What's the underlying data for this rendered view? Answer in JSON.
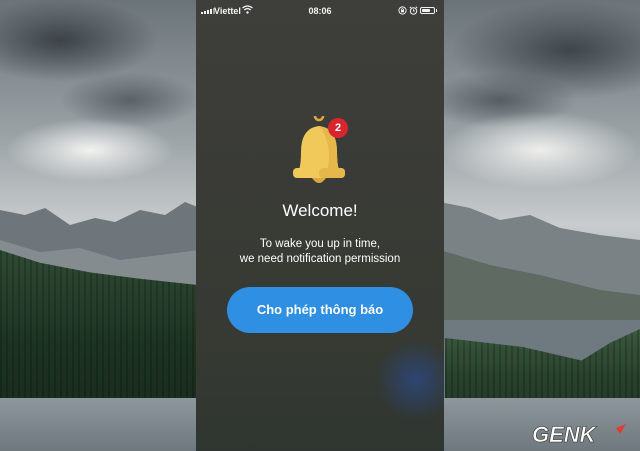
{
  "status_bar": {
    "carrier": "Viettel",
    "time": "08:06",
    "icons": [
      "signal-icon",
      "wifi-icon",
      "lock-rotation-icon",
      "alarm-icon",
      "battery-icon"
    ],
    "battery_level": 0.75
  },
  "welcome": {
    "icon": "bell-icon",
    "badge_count": "2",
    "title": "Welcome!",
    "message_lines": [
      "To wake you up in time,",
      "we need notification permission"
    ],
    "button_label": "Cho phép thông báo"
  },
  "watermark": {
    "brand": "GENK"
  },
  "colors": {
    "button": "#2f8fe3",
    "badge": "#d8262f",
    "bell": "#f1c85a",
    "screen_bg": "#3a3b36"
  }
}
